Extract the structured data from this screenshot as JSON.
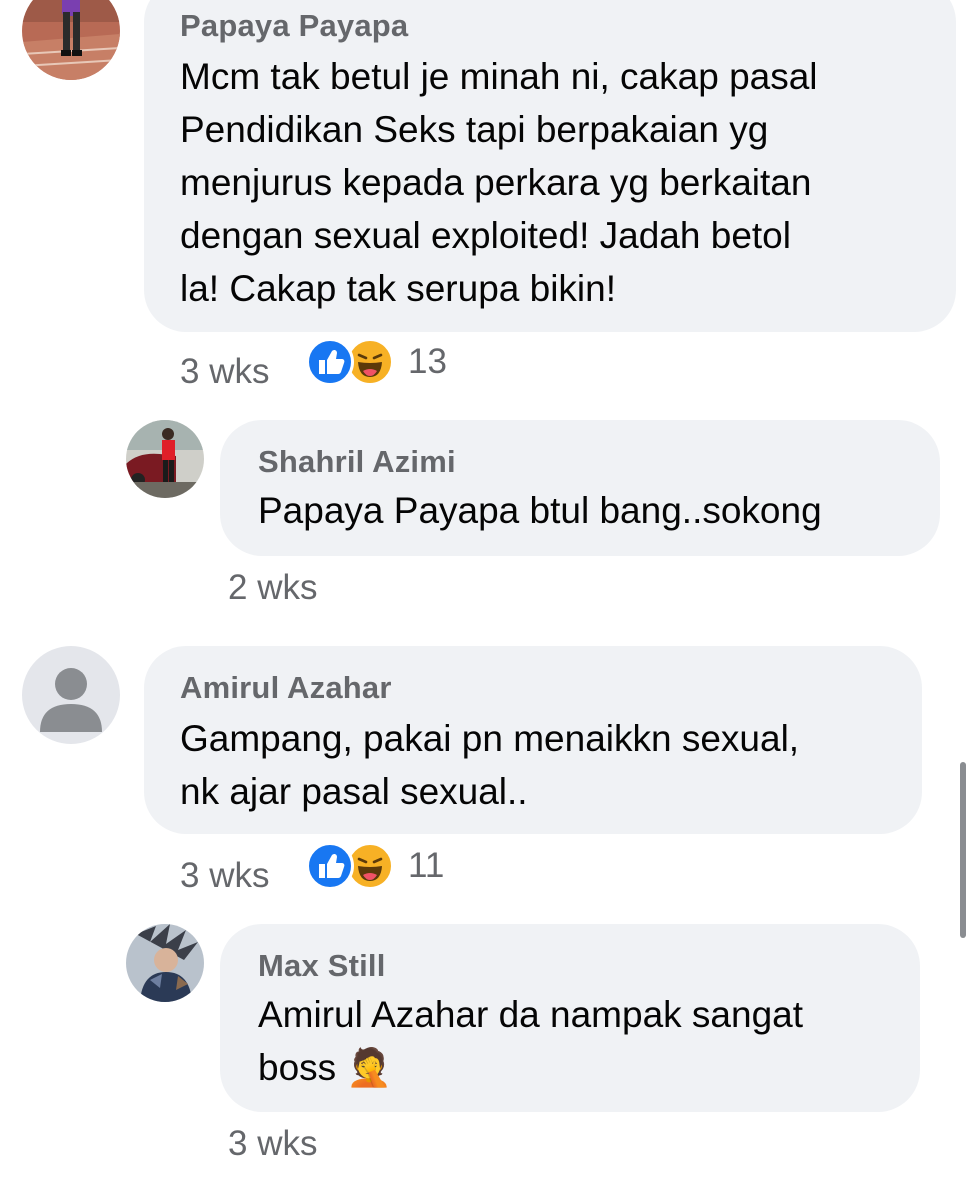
{
  "comments": [
    {
      "author": "Papaya Payapa",
      "lines": [
        "Mcm tak betul je minah ni, cakap pasal",
        "Pendidikan Seks tapi berpakaian yg",
        "menjurus kepada perkara yg berkaitan",
        "dengan sexual exploited! Jadah betol",
        "la! Cakap tak serupa bikin!"
      ],
      "time": "3 wks",
      "reactions": [
        "like-icon",
        "haha-icon"
      ],
      "reaction_count": "13",
      "avatar": "runner-photo-avatar"
    },
    {
      "author": "Shahril Azimi",
      "lines": [
        "Papaya Payapa btul bang..sokong"
      ],
      "time": "2 wks",
      "avatar": "car-photo-avatar"
    },
    {
      "author": "Amirul Azahar",
      "lines": [
        "Gampang, pakai pn menaikkn sexual,",
        "nk ajar pasal sexual.."
      ],
      "time": "3 wks",
      "reactions": [
        "like-icon",
        "haha-icon"
      ],
      "reaction_count": "11",
      "avatar": "default-person-avatar"
    },
    {
      "author": "Max Still",
      "lines": [
        "Amirul Azahar da nampak sangat",
        "boss 🤦"
      ],
      "time": "3 wks",
      "avatar": "anime-art-avatar"
    }
  ],
  "colors": {
    "bubble": "#f0f2f5",
    "author": "#65676b",
    "text": "#050505",
    "like": "#1877f2",
    "haha": "#f7b125"
  }
}
